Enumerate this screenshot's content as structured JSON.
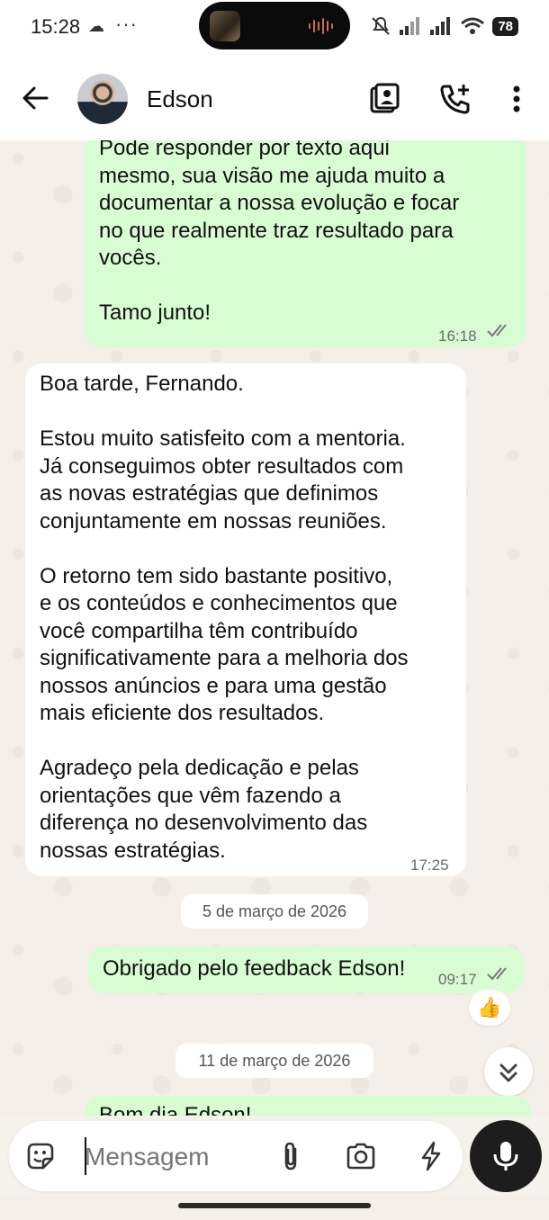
{
  "status_bar": {
    "time": "15:28",
    "dots": "···",
    "battery": "78"
  },
  "header": {
    "contact_name": "Edson"
  },
  "messages": [
    {
      "direction": "out",
      "text": "Pode responder por texto aqui\nmesmo, sua visão me ajuda muito a\ndocumentar a nossa evolução e focar\nno que realmente traz resultado para\nvocês.\n\nTamo junto!",
      "time": "16:18"
    },
    {
      "direction": "in",
      "text": "Boa tarde, Fernando.\n\nEstou muito satisfeito com a mentoria.\nJá conseguimos obter resultados com\nas novas estratégias que definimos\nconjuntamente em nossas reuniões.\n\nO retorno tem sido bastante positivo,\ne os conteúdos e conhecimentos que\nvocê compartilha têm contribuído\nsignificativamente para a melhoria dos\nnossos anúncios e para uma gestão\nmais eficiente dos resultados.\n\nAgradeço pela dedicação e pelas\norientações que vêm fazendo a\ndiferença no desenvolvimento das\nnossas estratégias.",
      "time": "17:25"
    },
    {
      "direction": "out",
      "text": "Obrigado pelo feedback Edson!",
      "time": "09:17",
      "reaction": "👍"
    },
    {
      "direction": "out",
      "text": "Bom dia Edson!"
    }
  ],
  "date_chips": [
    "5 de março de 2026",
    "11 de março de 2026"
  ],
  "composer": {
    "placeholder": "Mensagem"
  },
  "colors": {
    "outgoing_bubble": "#d9fdd3",
    "incoming_bubble": "#ffffff",
    "chat_background": "#f4efe8"
  }
}
